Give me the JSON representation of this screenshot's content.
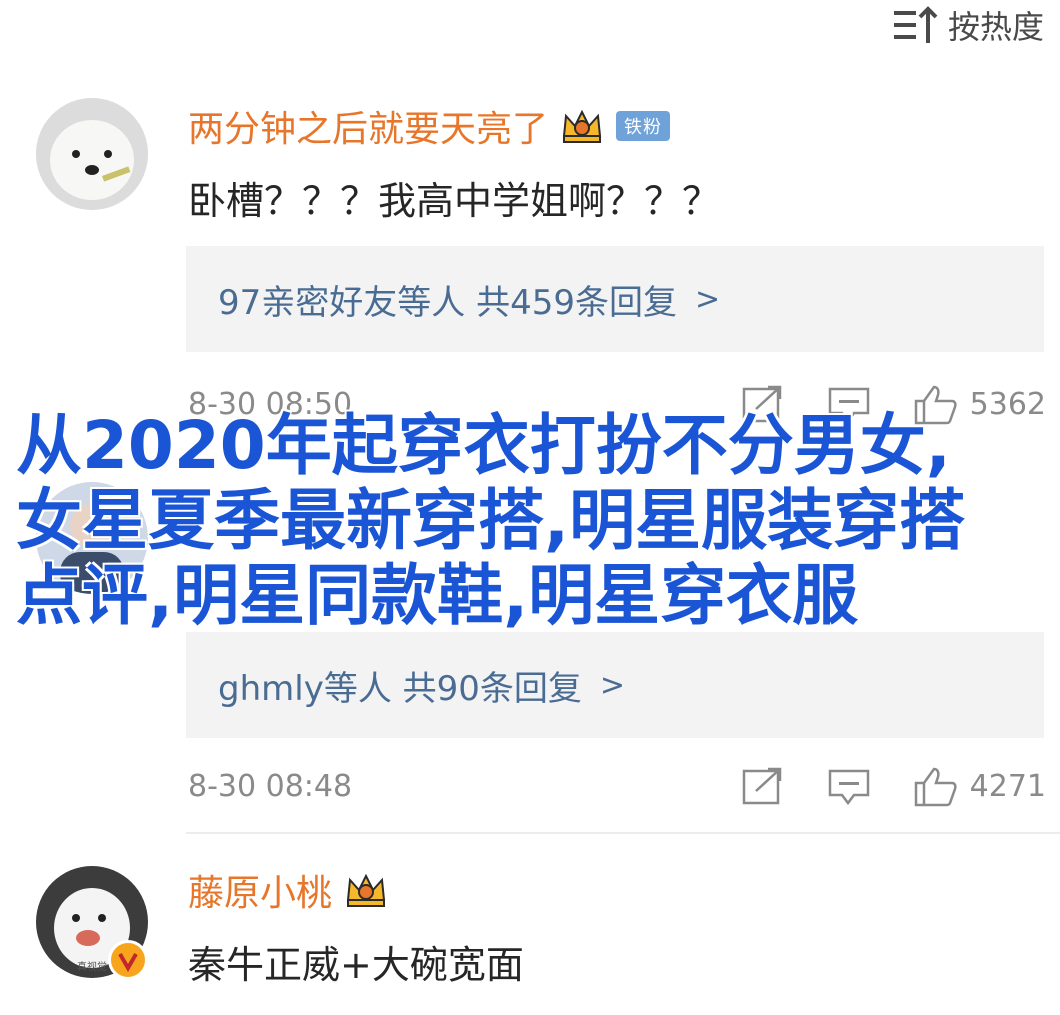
{
  "sort": {
    "label": "按热度",
    "icon": "sort-icon"
  },
  "comments": [
    {
      "username": "两分钟之后就要天亮了",
      "badge_icon": "crown-icon",
      "fan_badge": "铁粉",
      "content": "卧槽？？？我高中学姐啊？？？",
      "reply_summary": "97亲密好友等人 共459条回复",
      "time": "8-30 08:50",
      "likes": "5362"
    },
    {
      "username": "",
      "content": "",
      "reply_summary": "ghmly等人 共90条回复",
      "time": "8-30 08:48",
      "likes": "4271"
    },
    {
      "username": "藤原小桃",
      "badge_icon": "crown-icon",
      "content": "秦牛正威+大碗宽面",
      "avatar_caption": "真视觉"
    }
  ],
  "overlay_text": "从2020年起穿衣打扮不分男女,女星夏季最新穿搭,明星服装穿搭点评,明星同款鞋,明星穿衣服",
  "colors": {
    "username": "#e8762a",
    "reply_link": "#4a6c93",
    "overlay": "#1a55d6",
    "fan_badge": "#6fa2d9",
    "verified": "#f7a51d"
  }
}
